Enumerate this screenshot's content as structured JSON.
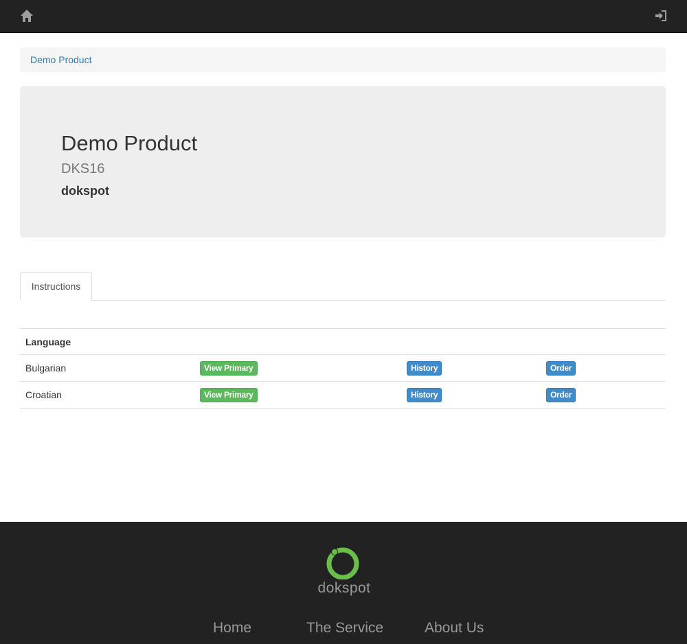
{
  "nav": {
    "home_icon": "home-icon",
    "login_icon": "sign-in-icon"
  },
  "breadcrumb": {
    "current": "Demo Product"
  },
  "product": {
    "title": "Demo Product",
    "code": "DKS16",
    "brand": "dokspot"
  },
  "tabs": [
    {
      "label": "Instructions"
    }
  ],
  "table": {
    "header": "Language",
    "rows": [
      {
        "language": "Bulgarian",
        "view_label": "View Primary",
        "history_label": "History",
        "order_label": "Order"
      },
      {
        "language": "Croatian",
        "view_label": "View Primary",
        "history_label": "History",
        "order_label": "Order"
      }
    ]
  },
  "footer": {
    "logo_text": "dokspot",
    "links": [
      {
        "label": "Home"
      },
      {
        "label": "The Service"
      },
      {
        "label": "About Us"
      }
    ]
  },
  "colors": {
    "navbar": "#222222",
    "link": "#337ab7",
    "success": "#5cb85c",
    "primary": "#428bca",
    "logo_green": "#6abf4b"
  }
}
